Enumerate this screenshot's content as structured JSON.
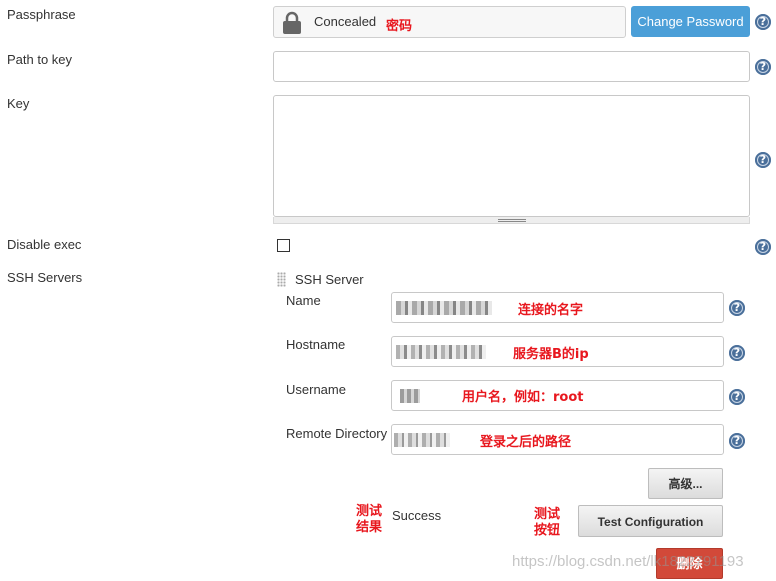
{
  "passphrase": {
    "label": "Passphrase",
    "status": "Concealed",
    "annotation": "密码",
    "change_button": "Change Password",
    "help": "?"
  },
  "path_to_key": {
    "label": "Path to key",
    "value": "",
    "help": "?"
  },
  "key": {
    "label": "Key",
    "value": "",
    "help": "?"
  },
  "disable_exec": {
    "label": "Disable exec",
    "checked": false,
    "help": "?"
  },
  "ssh_servers": {
    "label": "SSH Servers",
    "server_header": "SSH Server",
    "name": {
      "label": "Name",
      "annotation": "连接的名字",
      "help": "?"
    },
    "hostname": {
      "label": "Hostname",
      "annotation": "服务器B的ip",
      "help": "?"
    },
    "username": {
      "label": "Username",
      "annotation": "用户名，例如：root",
      "help": "?"
    },
    "remote_directory": {
      "label": "Remote Directory",
      "annotation": "登录之后的路径",
      "help": "?"
    },
    "advanced_button": "高级...",
    "test_result_annotation": [
      "测试",
      "结果"
    ],
    "test_result": "Success",
    "test_button_annotation": [
      "测试",
      "按钮"
    ],
    "test_button": "Test Configuration",
    "delete_button": "删除"
  },
  "watermark": "https://blog.csdn.net/lk1822791193",
  "colors": {
    "primary_button": "#4b9fd8",
    "delete_button": "#d24939",
    "annotation": "#e8171e",
    "help_icon": "#4a6f9a"
  }
}
